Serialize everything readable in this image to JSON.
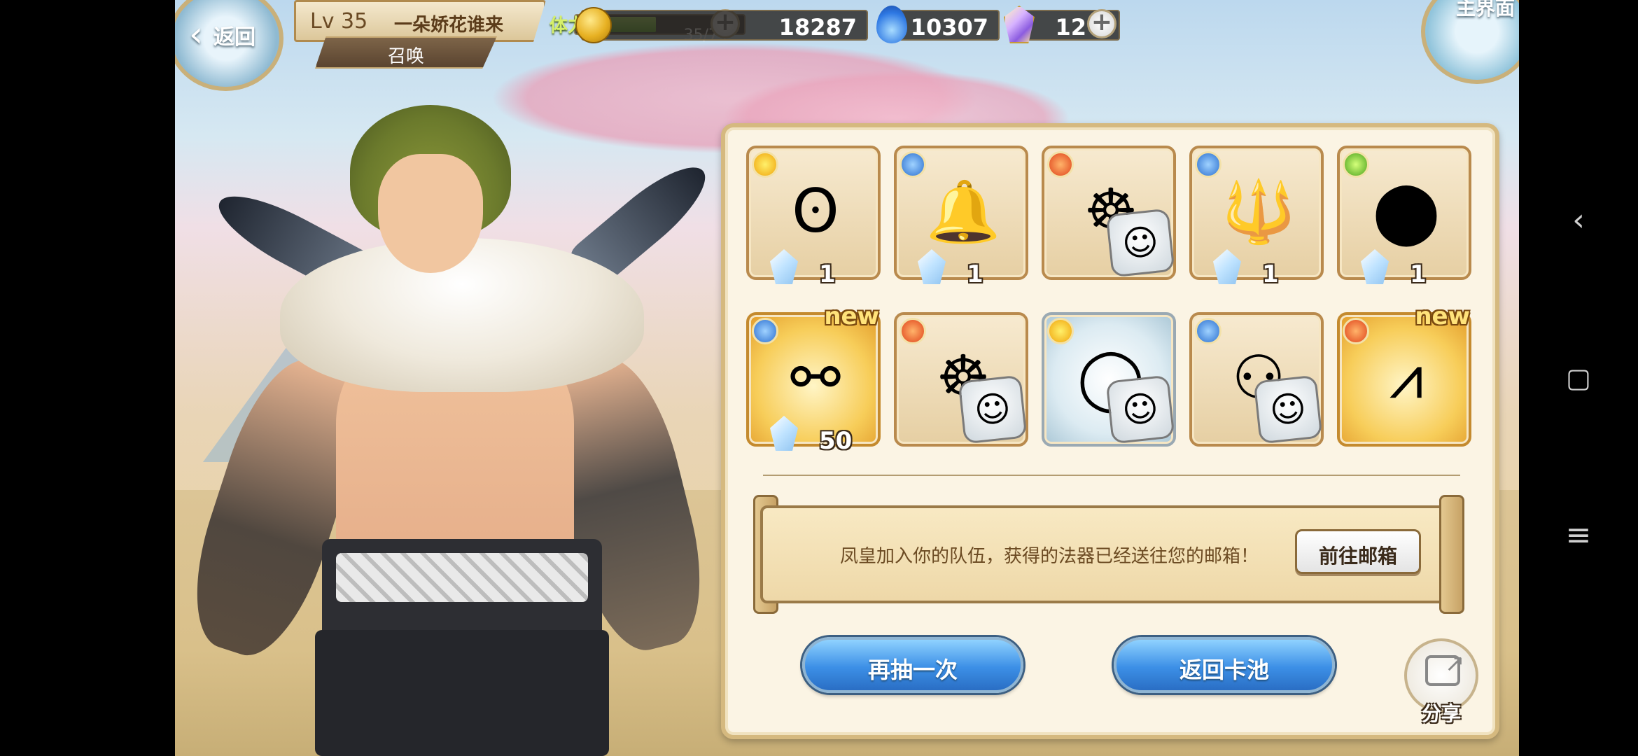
{
  "header": {
    "back_label": "返回",
    "level": "Lv 35",
    "player_name": "一朵娇花谁来",
    "tab_label": "召唤",
    "stamina_label": "体力",
    "stamina_value": "35/74",
    "stamina_fraction": 0.47,
    "gold": "18287",
    "blue_currency": "10307",
    "gems": "12",
    "home_label": "主界面"
  },
  "results": [
    {
      "element": "light",
      "art": "ʘ",
      "qty": "1",
      "new": "",
      "frame": "normal",
      "portrait": false
    },
    {
      "element": "water",
      "art": "🔔",
      "qty": "1",
      "new": "",
      "frame": "normal",
      "portrait": false
    },
    {
      "element": "fire",
      "art": "☸",
      "qty": "",
      "new": "",
      "frame": "normal",
      "portrait": true
    },
    {
      "element": "water",
      "art": "🔱",
      "qty": "1",
      "new": "",
      "frame": "normal",
      "portrait": false
    },
    {
      "element": "wind",
      "art": "⬤",
      "qty": "1",
      "new": "",
      "frame": "normal",
      "portrait": false
    },
    {
      "element": "water",
      "art": "⚯",
      "qty": "50",
      "new": "new",
      "frame": "gold",
      "portrait": false
    },
    {
      "element": "fire",
      "art": "☸",
      "qty": "",
      "new": "",
      "frame": "normal",
      "portrait": true
    },
    {
      "element": "light",
      "art": "◯",
      "qty": "",
      "new": "",
      "frame": "silver",
      "portrait": true
    },
    {
      "element": "water",
      "art": "⚇",
      "qty": "",
      "new": "",
      "frame": "normal",
      "portrait": true
    },
    {
      "element": "fire",
      "art": "⩘",
      "qty": "",
      "new": "new",
      "frame": "gold",
      "portrait": false
    }
  ],
  "message": "凤皇加入你的队伍，获得的法器已经送往您的邮箱！",
  "mailbox_button": "前往邮箱",
  "draw_again_button": "再抽一次",
  "return_pool_button": "返回卡池",
  "share_label": "分享",
  "colors": {
    "panel_border": "#d5b97f",
    "button_blue": "#3c8fe6",
    "stamina_green": "#60b41e"
  }
}
